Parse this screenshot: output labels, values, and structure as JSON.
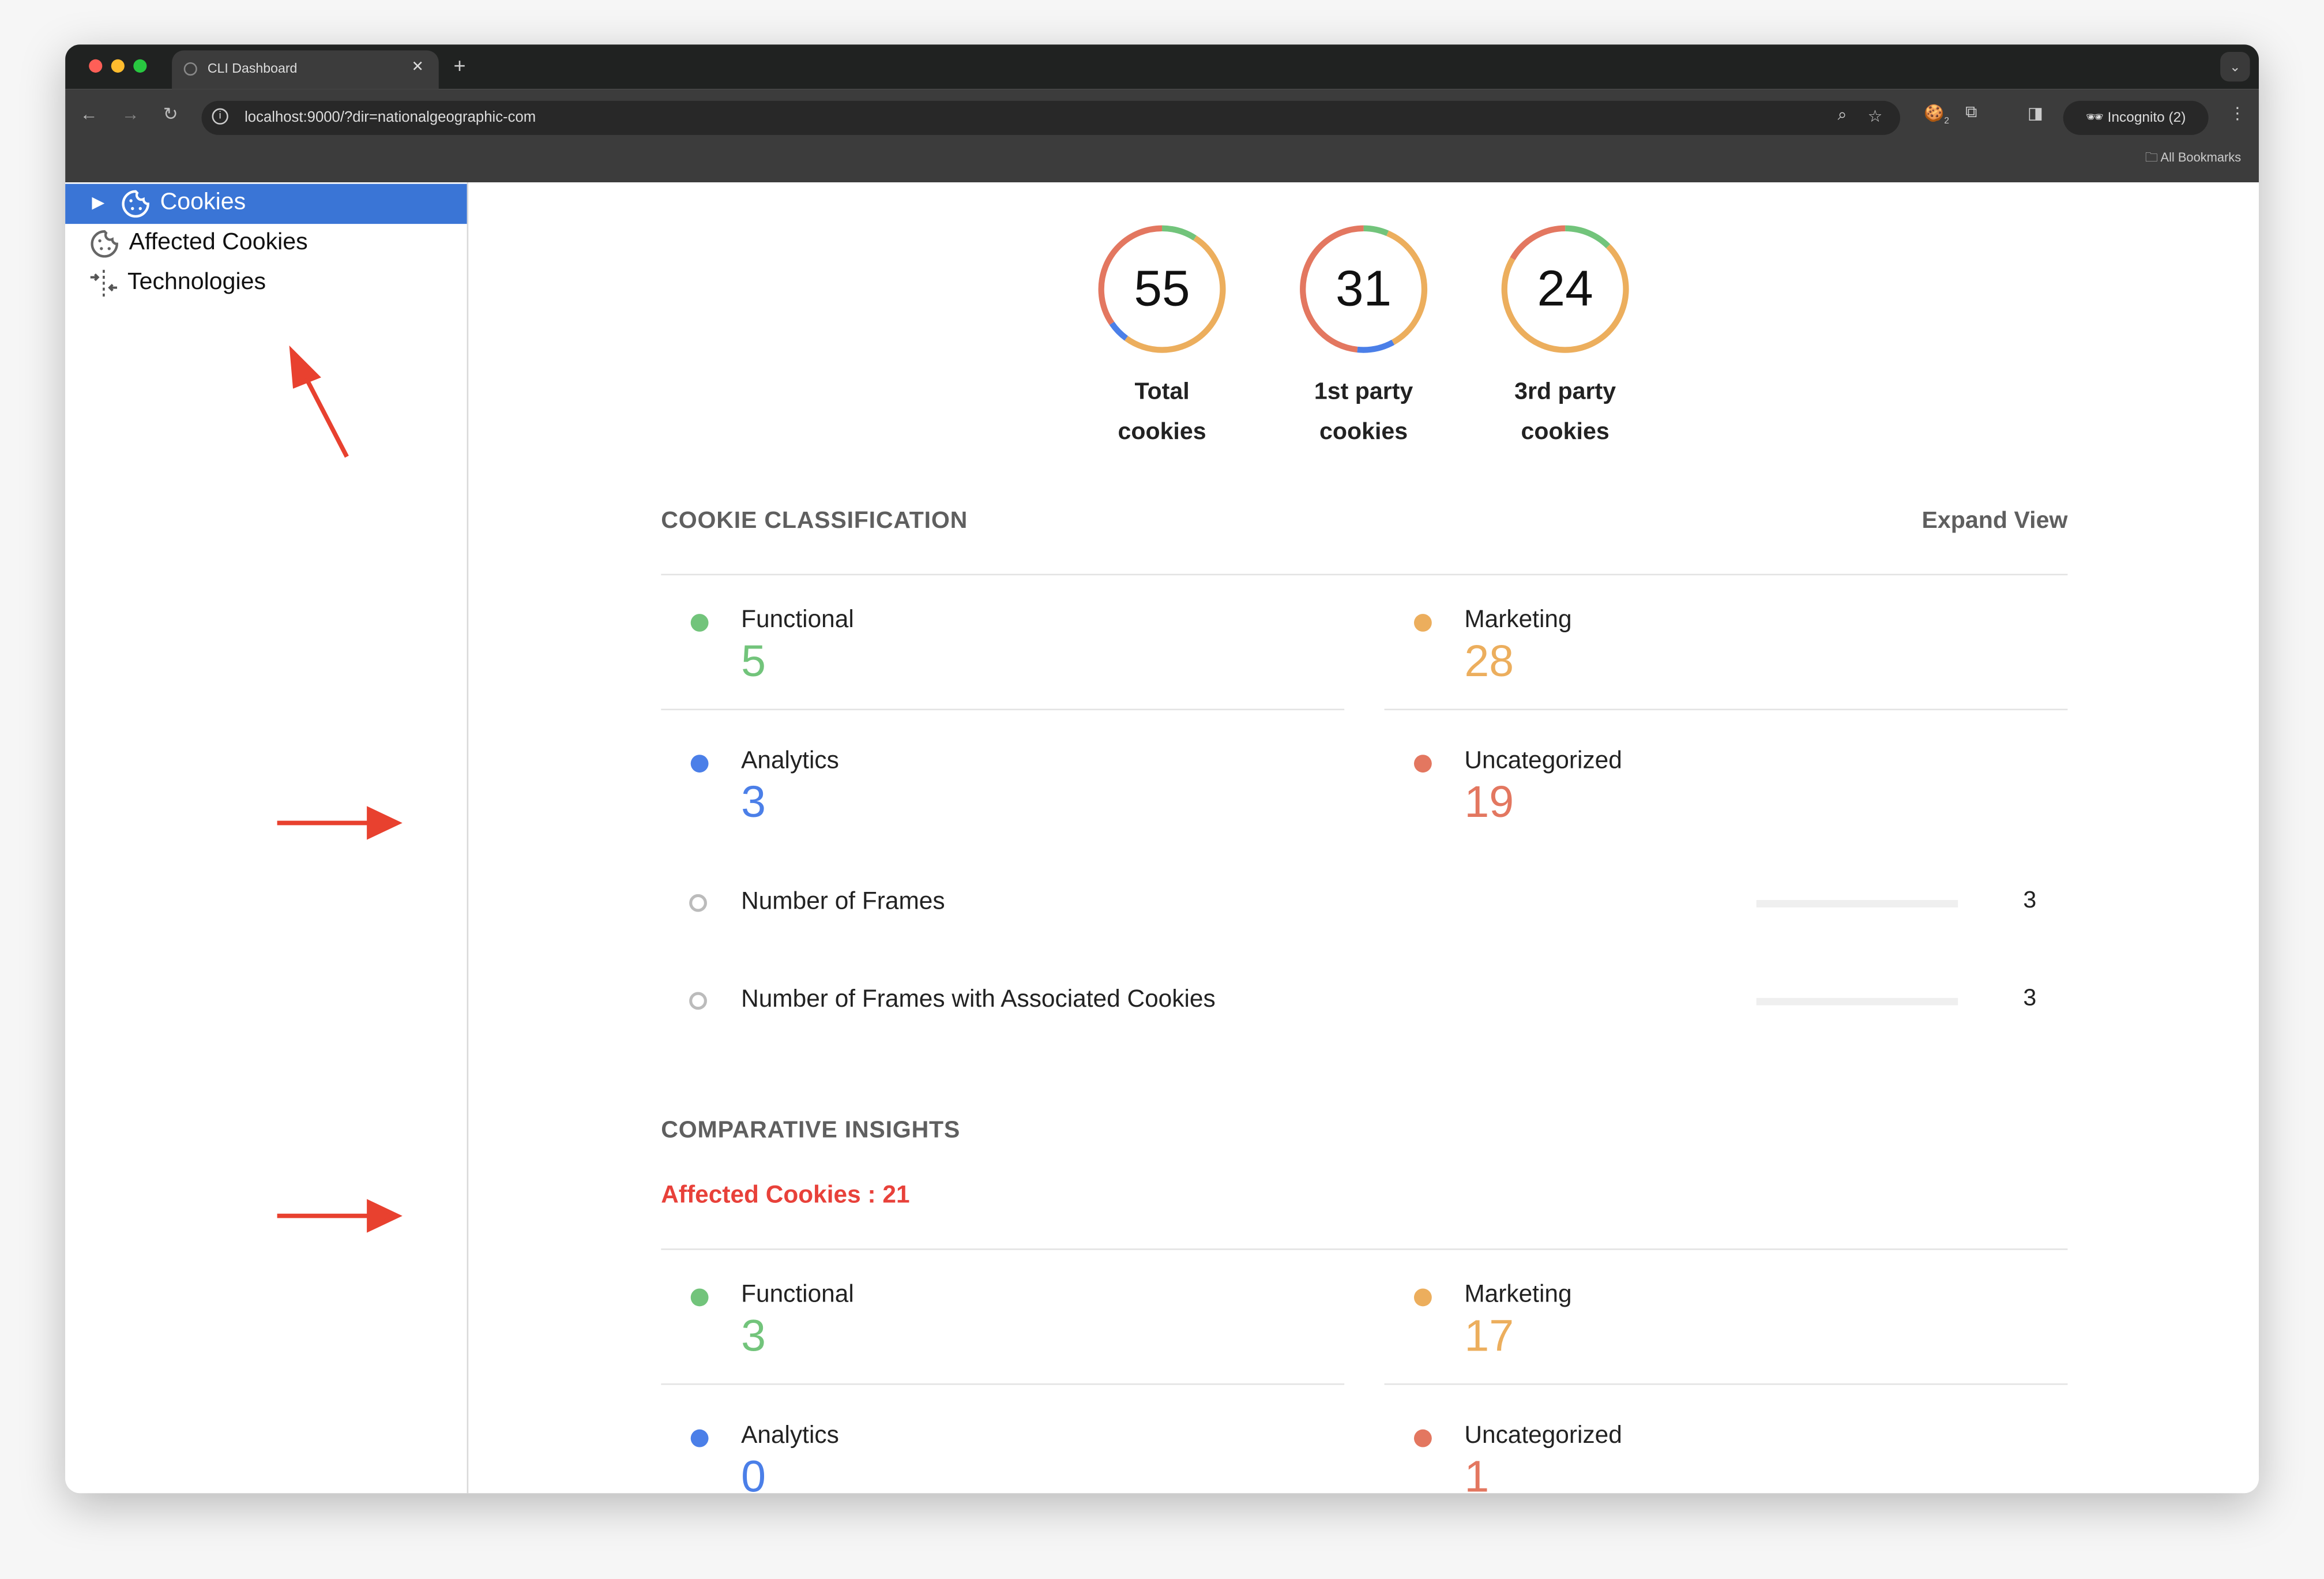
{
  "browser": {
    "tab_title": "CLI Dashboard",
    "url": "localhost:9000/?dir=nationalgeographic-com",
    "incognito_label": "Incognito (2)",
    "bookmarks_label": "All Bookmarks",
    "extension_badge": "2"
  },
  "sidebar": {
    "items": [
      {
        "label": "Cookies",
        "selected": true,
        "icon": "cookie-icon"
      },
      {
        "label": "Affected Cookies",
        "selected": false,
        "icon": "cookie-icon"
      },
      {
        "label": "Technologies",
        "selected": false,
        "icon": "technologies-icon"
      }
    ]
  },
  "colors": {
    "functional": "#72c47b",
    "marketing": "#ecae5d",
    "analytics": "#4b7fe8",
    "uncategorized": "#e37760",
    "accent": "#3a75d6",
    "affected": "#e8413a"
  },
  "summary": [
    {
      "value": "55",
      "label_line1": "Total",
      "label_line2": "cookies",
      "breakdown": {
        "functional": 5,
        "marketing": 28,
        "analytics": 3,
        "uncategorized": 19
      }
    },
    {
      "value": "31",
      "label_line1": "1st party",
      "label_line2": "cookies",
      "breakdown": {
        "functional": 2,
        "marketing": 11,
        "analytics": 3,
        "uncategorized": 15
      }
    },
    {
      "value": "24",
      "label_line1": "3rd party",
      "label_line2": "cookies",
      "breakdown": {
        "functional": 3,
        "marketing": 17,
        "analytics": 0,
        "uncategorized": 4
      }
    }
  ],
  "classification": {
    "title": "COOKIE CLASSIFICATION",
    "expand_label": "Expand View",
    "categories": [
      {
        "name": "Functional",
        "value": "5"
      },
      {
        "name": "Marketing",
        "value": "28"
      },
      {
        "name": "Analytics",
        "value": "3"
      },
      {
        "name": "Uncategorized",
        "value": "19"
      }
    ],
    "frames": [
      {
        "name": "Number of Frames",
        "value": "3"
      },
      {
        "name": "Number of Frames with Associated Cookies",
        "value": "3"
      }
    ]
  },
  "insights": {
    "title": "COMPARATIVE INSIGHTS",
    "affected_label": "Affected Cookies : 21",
    "categories": [
      {
        "name": "Functional",
        "value": "3"
      },
      {
        "name": "Marketing",
        "value": "17"
      },
      {
        "name": "Analytics",
        "value": "0"
      },
      {
        "name": "Uncategorized",
        "value": "1"
      }
    ]
  }
}
